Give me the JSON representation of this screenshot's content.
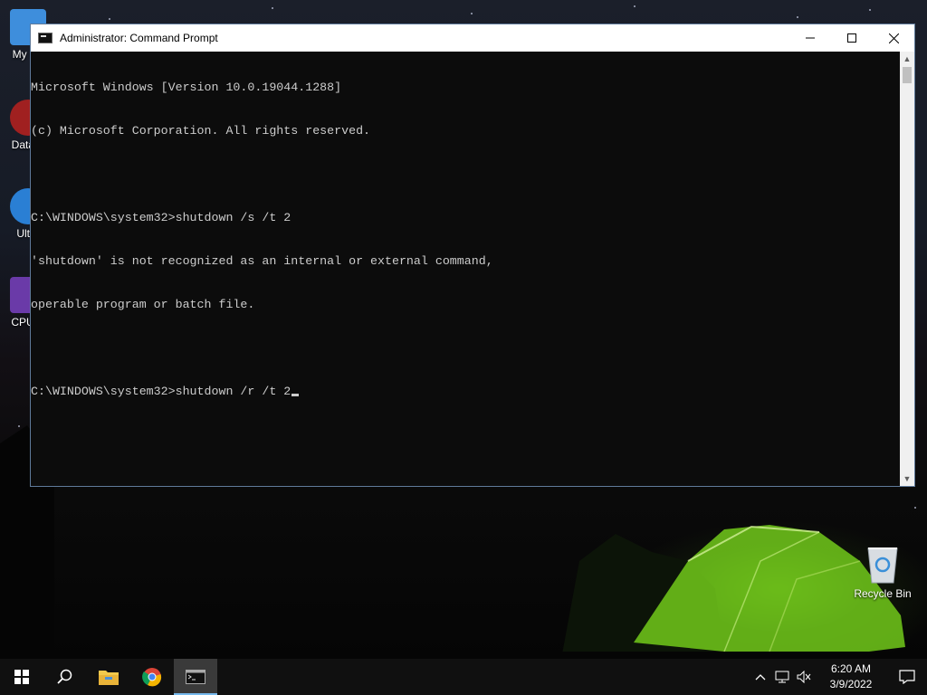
{
  "window": {
    "title": "Administrator: Command Prompt",
    "controls": {
      "minimize": "—",
      "maximize": "☐",
      "close": "✕"
    }
  },
  "console": {
    "lines": [
      "Microsoft Windows [Version 10.0.19044.1288]",
      "(c) Microsoft Corporation. All rights reserved.",
      "",
      "C:\\WINDOWS\\system32>shutdown /s /t 2",
      "'shutdown' is not recognized as an internal or external command,",
      "operable program or batch file.",
      "",
      "C:\\WINDOWS\\system32>shutdown /r /t 2"
    ]
  },
  "desktop": {
    "icons": [
      {
        "label": "My Co",
        "icon": "my-computer-icon"
      },
      {
        "label": "DataW",
        "icon": "datawarehouse-icon"
      },
      {
        "label": "Ultra",
        "icon": "ultra-icon"
      },
      {
        "label": "CPUID",
        "icon": "cpuid-icon"
      }
    ],
    "recycle_bin": {
      "label": "Recycle Bin",
      "icon": "recycle-bin-icon"
    }
  },
  "taskbar": {
    "apps": [
      "start-icon",
      "search-icon",
      "file-explorer-icon",
      "chrome-icon",
      "command-prompt-icon"
    ],
    "clock": {
      "time": "6:20 AM",
      "date": "3/9/2022"
    },
    "tray": [
      "chevron-up-icon",
      "network-icon",
      "volume-muted-icon",
      "notification-icon"
    ]
  },
  "colors": {
    "console_bg": "#0c0c0c",
    "console_fg": "#cccccc",
    "taskbar_bg": "#101010",
    "accent": "#76b9ed"
  }
}
